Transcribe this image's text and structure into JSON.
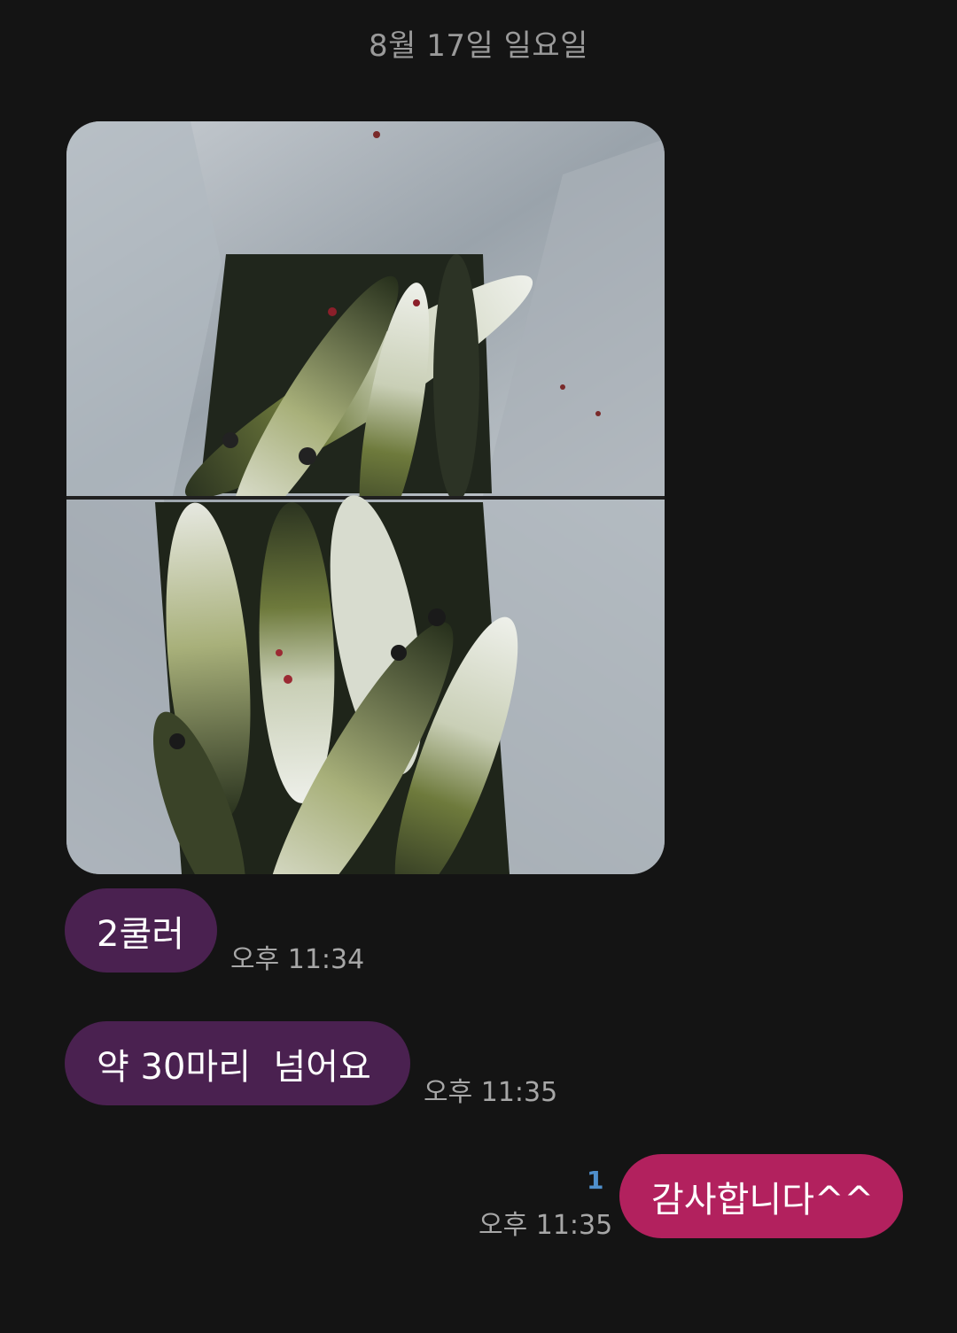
{
  "date_divider": "8월 17일 일요일",
  "messages": [
    {
      "id": "photo",
      "type": "image",
      "direction": "incoming",
      "description_icon": "fish-photo"
    },
    {
      "id": "m1",
      "direction": "incoming",
      "text": "2쿨러",
      "time": "오후 11:34"
    },
    {
      "id": "m2",
      "direction": "incoming",
      "text": "약 30마리  넘어요",
      "time": "오후 11:35"
    },
    {
      "id": "m3",
      "direction": "outgoing",
      "text": "감사합니다^^",
      "time": "오후 11:35",
      "unread_count": "1"
    }
  ],
  "colors": {
    "background": "#141414",
    "incoming_bubble": "#4a2150",
    "outgoing_bubble": "#b2215e",
    "time_text": "#a7a7a7",
    "unread_count": "#4f8fcc"
  }
}
